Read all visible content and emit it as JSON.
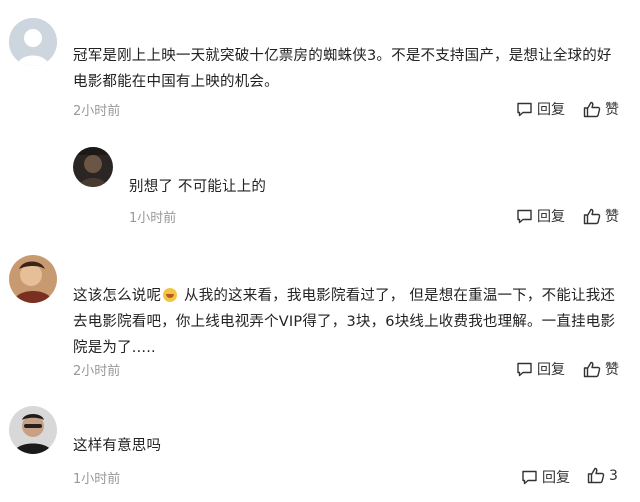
{
  "comments": [
    {
      "text": "冠军是刚上上映一天就突破十亿票房的蜘蛛侠3。不是不支持国产，是想让全球的好电影都能在中国有上映的机会。",
      "time": "2小时前",
      "reply": "回复",
      "like": "赞"
    },
    {
      "text": "别想了 不可能让上的",
      "time": "1小时前",
      "reply": "回复",
      "like": "赞"
    },
    {
      "text_before_emoji": "这该怎么说呢",
      "text_after_emoji": " 从我的这来看，我电影院看过了， 但是想在重温一下，不能让我还去电影院看吧，你上线电视弄个VIP得了，3块，6块线上收费我也理解。一直挂电影院是为了.....",
      "time": "2小时前",
      "reply": "回复",
      "like": "赞"
    },
    {
      "text": "这样有意思吗",
      "time": "1小时前",
      "reply": "回复",
      "like_count": "3"
    }
  ]
}
